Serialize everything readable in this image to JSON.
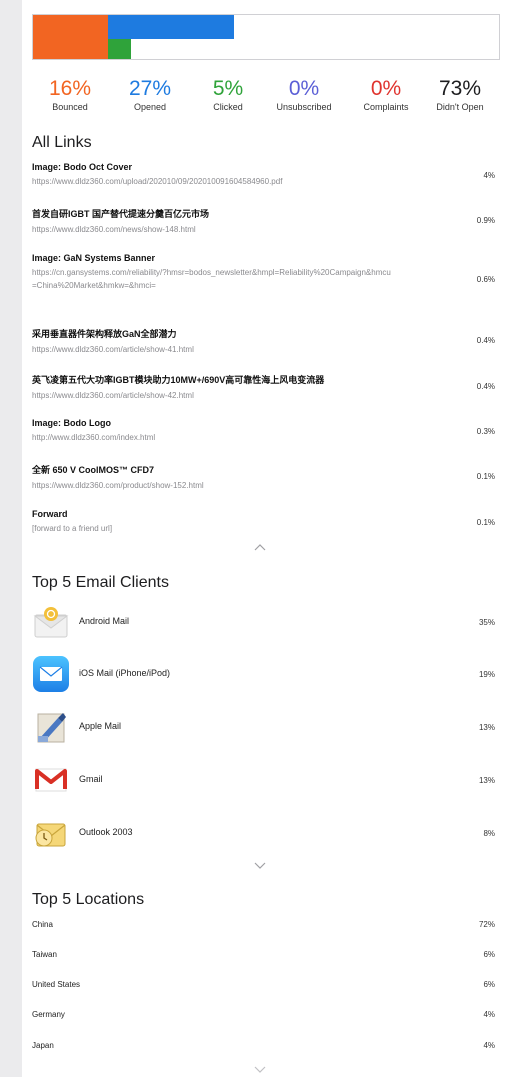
{
  "bar": {
    "segments": [
      {
        "name": "bounced",
        "fraction": 0.16,
        "color": "#f26522"
      },
      {
        "name": "opened",
        "fraction": 0.27,
        "color": "#1e7be0"
      },
      {
        "name": "clicked",
        "fraction": 0.05,
        "color": "#2fa33a"
      }
    ]
  },
  "stats": [
    {
      "pct": "16%",
      "label": "Bounced",
      "color": "#f26522"
    },
    {
      "pct": "27%",
      "label": "Opened",
      "color": "#1e7be0"
    },
    {
      "pct": "5%",
      "label": "Clicked",
      "color": "#2fa33a"
    },
    {
      "pct": "0%",
      "label": "Unsubscribed",
      "color": "#5b5fd6"
    },
    {
      "pct": "0%",
      "label": "Complaints",
      "color": "#e0342f"
    },
    {
      "pct": "73%",
      "label": "Didn't Open",
      "color": "#1d1d1f"
    }
  ],
  "links": {
    "title": "All Links",
    "items": [
      {
        "title": "Image: Bodo Oct Cover",
        "url": "https://www.dldz360.com/upload/202010/09/202010091604584960.pdf",
        "value": "4%"
      },
      {
        "title": "首发自研IGBT 国产替代提速分羹百亿元市场",
        "url": "https://www.dldz360.com/news/show-148.html",
        "value": "0.9%"
      },
      {
        "title": "Image: GaN Systems Banner",
        "url": "https://cn.gansystems.com/reliability/?hmsr=bodos_newsletter&hmpl=Reliability%20Campaign&hmcu=China%20Market&hmkw=&hmci=",
        "value": "0.6%"
      },
      {
        "title": "采用垂直器件架构释放GaN全部潜力",
        "url": "https://www.dldz360.com/article/show-41.html",
        "value": "0.4%"
      },
      {
        "title": "英飞凌第五代大功率IGBT模块助力10MW+/690V高可靠性海上风电变流器",
        "url": "https://www.dldz360.com/article/show-42.html",
        "value": "0.4%"
      },
      {
        "title": "Image: Bodo Logo",
        "url": "http://www.dldz360.com/index.html",
        "value": "0.3%"
      },
      {
        "title": "全新 650 V CoolMOS™ CFD7",
        "url": "https://www.dldz360.com/product/show-152.html",
        "value": "0.1%"
      },
      {
        "title": "Forward",
        "url": "[forward to a friend url]",
        "value": "0.1%"
      }
    ]
  },
  "clients": {
    "title": "Top 5 Email Clients",
    "items": [
      {
        "name": "Android Mail",
        "value": "35%",
        "icon": "android-mail-icon"
      },
      {
        "name": "iOS Mail (iPhone/iPod)",
        "value": "19%",
        "icon": "ios-mail-icon"
      },
      {
        "name": "Apple Mail",
        "value": "13%",
        "icon": "apple-mail-icon"
      },
      {
        "name": "Gmail",
        "value": "13%",
        "icon": "gmail-icon"
      },
      {
        "name": "Outlook 2003",
        "value": "8%",
        "icon": "outlook-icon"
      }
    ]
  },
  "locations": {
    "title": "Top 5 Locations",
    "items": [
      {
        "name": "China",
        "value": "72%"
      },
      {
        "name": "Taiwan",
        "value": "6%"
      },
      {
        "name": "United States",
        "value": "6%"
      },
      {
        "name": "Germany",
        "value": "4%"
      },
      {
        "name": "Japan",
        "value": "4%"
      }
    ]
  },
  "icons": {
    "collapse": "chevron-up-icon",
    "expand": "chevron-down-icon"
  }
}
